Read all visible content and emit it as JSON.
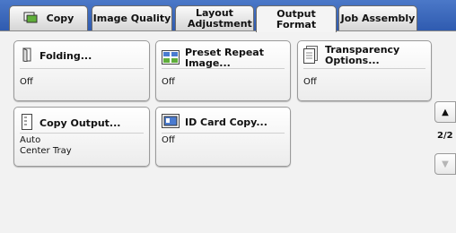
{
  "tabs": [
    {
      "label": "Copy",
      "active": false
    },
    {
      "label": "Image Quality",
      "active": false
    },
    {
      "label": "Layout Adjustment",
      "active": false
    },
    {
      "label": "Output Format",
      "active": true
    },
    {
      "label": "Job Assembly",
      "active": false
    }
  ],
  "buttons": {
    "folding": {
      "title": "Folding...",
      "value": "Off"
    },
    "preset_repeat": {
      "title": "Preset Repeat Image...",
      "value": "Off"
    },
    "transparency": {
      "title": "Transparency Options...",
      "value": "Off"
    },
    "copy_output": {
      "title": "Copy Output...",
      "value_line1": "Auto",
      "value_line2": "Center Tray"
    },
    "id_card": {
      "title": "ID Card Copy...",
      "value": "Off"
    }
  },
  "pager": {
    "text": "2/2",
    "up_icon": "triangle-up-icon",
    "down_icon": "triangle-down-icon"
  },
  "colors": {
    "tabbar": "#2f5bb0",
    "accent_green": "#5fae3a"
  }
}
